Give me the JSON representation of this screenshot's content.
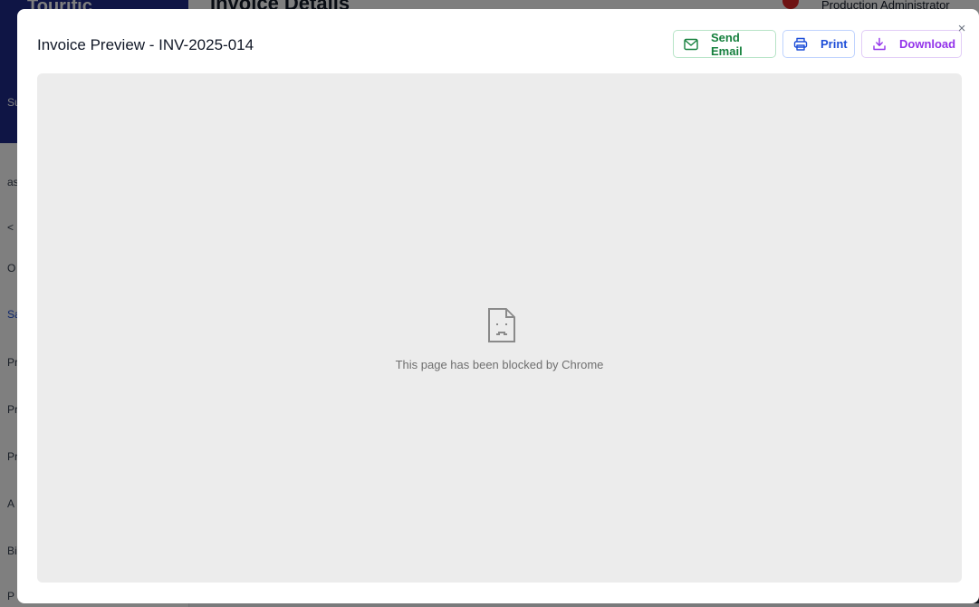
{
  "background": {
    "brand": "Tourific",
    "brand_sub": "Su",
    "page_title": "Invoice Details",
    "user": "Production Administrator",
    "sidebar_fragments": [
      "ask",
      "<",
      "O",
      "Sa",
      "Pr",
      "Pr",
      "Pr",
      "A",
      "Bi",
      "P"
    ]
  },
  "modal": {
    "title": "Invoice Preview - INV-2025-014",
    "close_glyph": "×",
    "buttons": {
      "send_email": "Send Email",
      "print": "Print",
      "download": "Download"
    },
    "preview": {
      "blocked_message": "This page has been blocked by Chrome",
      "icon": "sad-document-icon"
    }
  },
  "colors": {
    "email": "#15803d",
    "print": "#1d4ed8",
    "download": "#9333ea",
    "preview_bg": "#ececec"
  }
}
